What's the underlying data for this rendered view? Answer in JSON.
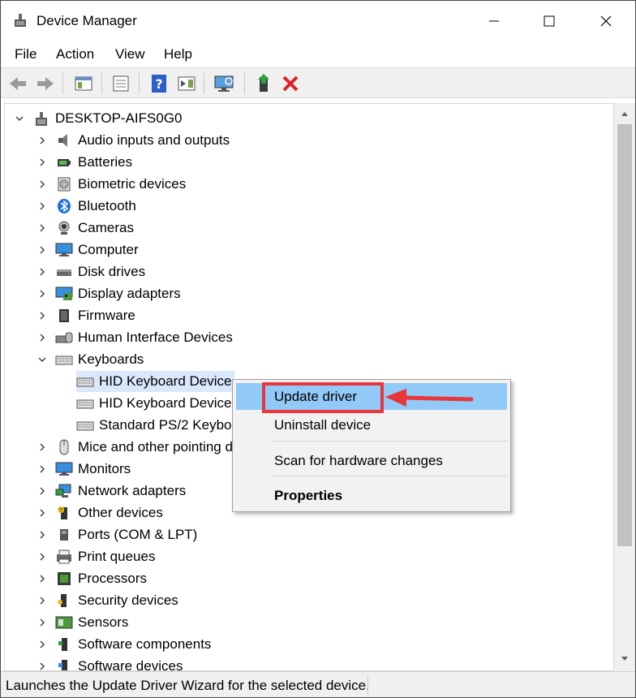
{
  "window": {
    "title": "Device Manager"
  },
  "menu": [
    "File",
    "Action",
    "View",
    "Help"
  ],
  "toolbar": {
    "buttons": [
      "back-icon",
      "forward-icon",
      "show-hide-console-tree-icon",
      "properties-icon",
      "help-icon",
      "action-pane-icon",
      "scan-hardware-icon",
      "update-driver-icon",
      "uninstall-icon"
    ]
  },
  "tree": {
    "root": "DESKTOP-AIFS0G0",
    "categories": [
      {
        "label": "Audio inputs and outputs",
        "icon": "speaker-icon"
      },
      {
        "label": "Batteries",
        "icon": "battery-icon"
      },
      {
        "label": "Biometric devices",
        "icon": "fingerprint-icon"
      },
      {
        "label": "Bluetooth",
        "icon": "bluetooth-icon"
      },
      {
        "label": "Cameras",
        "icon": "camera-icon"
      },
      {
        "label": "Computer",
        "icon": "monitor-icon"
      },
      {
        "label": "Disk drives",
        "icon": "disk-drive-icon"
      },
      {
        "label": "Display adapters",
        "icon": "display-adapter-icon"
      },
      {
        "label": "Firmware",
        "icon": "chip-icon"
      },
      {
        "label": "Human Interface Devices",
        "icon": "hid-icon"
      },
      {
        "label": "Keyboards",
        "icon": "keyboard-icon",
        "expanded": true,
        "children": [
          "HID Keyboard Device",
          "HID Keyboard Device",
          "Standard PS/2 Keyboard"
        ]
      },
      {
        "label": "Mice and other pointing devices",
        "icon": "mouse-icon"
      },
      {
        "label": "Monitors",
        "icon": "monitor-icon"
      },
      {
        "label": "Network adapters",
        "icon": "network-icon"
      },
      {
        "label": "Other devices",
        "icon": "unknown-device-icon"
      },
      {
        "label": "Ports (COM & LPT)",
        "icon": "port-icon"
      },
      {
        "label": "Print queues",
        "icon": "printer-icon"
      },
      {
        "label": "Processors",
        "icon": "processor-icon"
      },
      {
        "label": "Security devices",
        "icon": "security-device-icon"
      },
      {
        "label": "Sensors",
        "icon": "sensor-icon"
      },
      {
        "label": "Software components",
        "icon": "software-component-icon"
      },
      {
        "label": "Software devices",
        "icon": "software-device-icon"
      }
    ]
  },
  "context_menu": {
    "items": [
      {
        "label": "Update driver",
        "highlighted": true
      },
      {
        "label": "Uninstall device"
      },
      {
        "label": "Scan for hardware changes"
      },
      {
        "label": "Properties",
        "bold": true
      }
    ]
  },
  "status": {
    "text": "Launches the Update Driver Wizard for the selected device."
  },
  "colors": {
    "highlight": "#91c9f7",
    "selection": "#d9e8fb",
    "annotation": "#e8363a"
  }
}
